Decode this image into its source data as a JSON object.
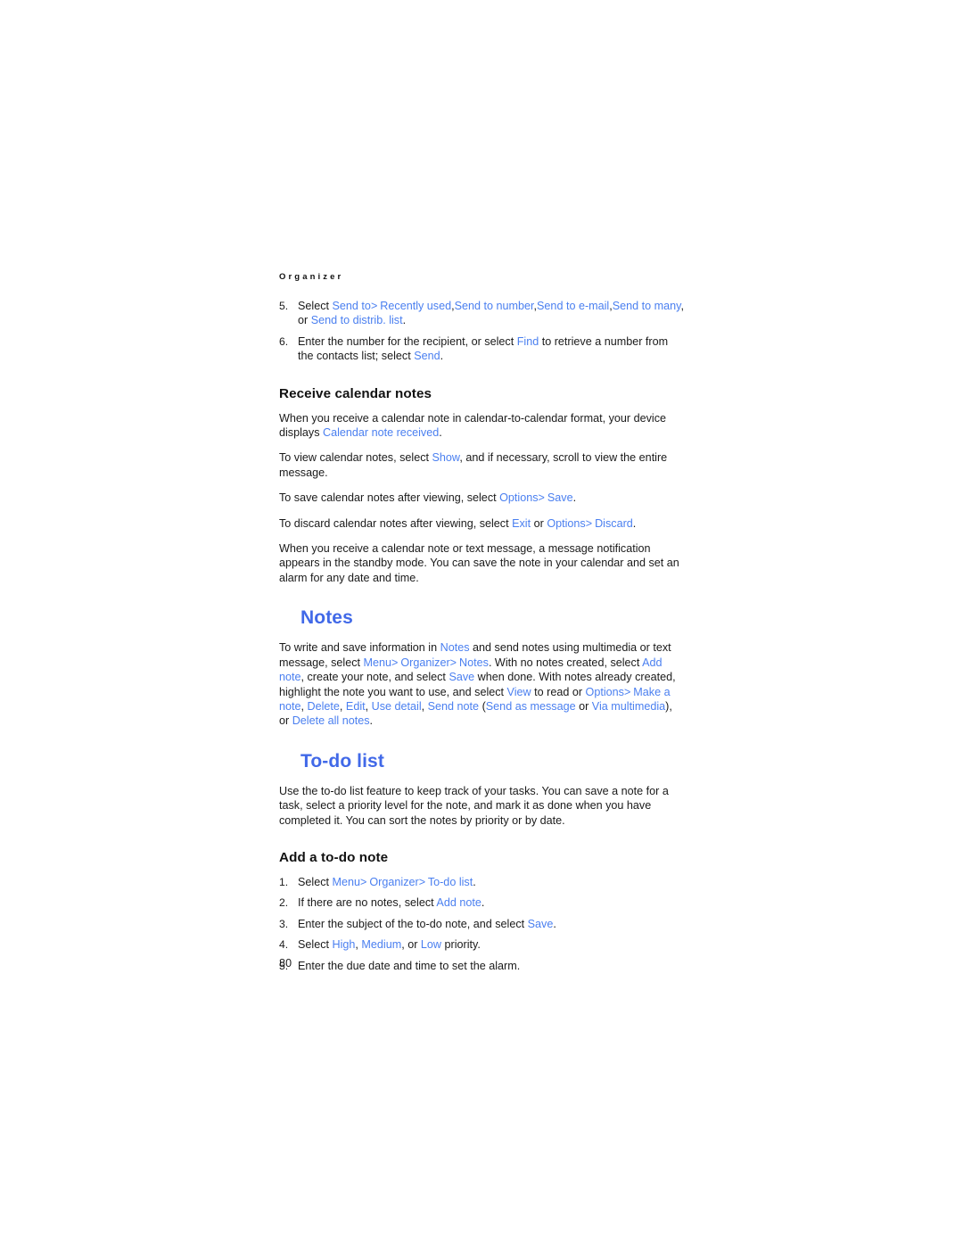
{
  "document": {
    "running_header": "Organizer",
    "page_number": "80",
    "accent_color": "#4a7ff0",
    "heading_color": "#4169e8",
    "body_color": "#1a1a1a"
  },
  "top_list": {
    "items": [
      {
        "number": "5.",
        "segments": [
          {
            "text": "Select ",
            "style": "body"
          },
          {
            "text": "Send to",
            "style": "ui"
          },
          {
            "text": ">",
            "style": "ui-sep"
          },
          {
            "text": " Recently used",
            "style": "ui"
          },
          {
            "text": ",",
            "style": "body"
          },
          {
            "text": "Send to number",
            "style": "ui"
          },
          {
            "text": ",",
            "style": "body"
          },
          {
            "text": "Send to e-mail",
            "style": "ui"
          },
          {
            "text": ",",
            "style": "body"
          },
          {
            "text": "Send to many",
            "style": "ui"
          },
          {
            "text": ", or ",
            "style": "body"
          },
          {
            "text": "Send to distrib. list",
            "style": "ui"
          },
          {
            "text": ".",
            "style": "body"
          }
        ]
      },
      {
        "number": "6.",
        "segments": [
          {
            "text": "Enter the number for the recipient, or select ",
            "style": "body"
          },
          {
            "text": "Find",
            "style": "ui"
          },
          {
            "text": " to retrieve a number from the contacts list; select ",
            "style": "body"
          },
          {
            "text": "Send",
            "style": "ui"
          },
          {
            "text": ".",
            "style": "body"
          }
        ]
      }
    ]
  },
  "receive_calendar_notes": {
    "heading": "Receive calendar notes",
    "paragraphs": [
      {
        "segments": [
          {
            "text": "When you receive a calendar note in calendar-to-calendar format, your device displays ",
            "style": "body"
          },
          {
            "text": "Calendar note received",
            "style": "ui"
          },
          {
            "text": ".",
            "style": "body"
          }
        ]
      },
      {
        "segments": [
          {
            "text": "To view calendar notes, select ",
            "style": "body"
          },
          {
            "text": "Show",
            "style": "ui"
          },
          {
            "text": ", and if necessary, scroll to view the entire message.",
            "style": "body"
          }
        ]
      },
      {
        "segments": [
          {
            "text": "To save calendar notes after viewing, select ",
            "style": "body"
          },
          {
            "text": "Options",
            "style": "ui"
          },
          {
            "text": ">",
            "style": "ui-sep"
          },
          {
            "text": " Save",
            "style": "ui"
          },
          {
            "text": ".",
            "style": "body"
          }
        ]
      },
      {
        "segments": [
          {
            "text": "To discard calendar notes after viewing, select ",
            "style": "body"
          },
          {
            "text": "Exit",
            "style": "ui"
          },
          {
            "text": " or ",
            "style": "body"
          },
          {
            "text": "Options",
            "style": "ui"
          },
          {
            "text": ">",
            "style": "ui-sep"
          },
          {
            "text": " Discard",
            "style": "ui"
          },
          {
            "text": ".",
            "style": "body"
          }
        ]
      },
      {
        "segments": [
          {
            "text": "When you receive a calendar note or text message, a message notification appears in the standby mode. You can save the note in your calendar and set an alarm for any date and time.",
            "style": "body"
          }
        ]
      }
    ]
  },
  "notes_section": {
    "heading": "Notes",
    "paragraphs": [
      {
        "segments": [
          {
            "text": "To write and save information in ",
            "style": "body"
          },
          {
            "text": "Notes",
            "style": "ui"
          },
          {
            "text": " and send notes using multimedia or text message, select ",
            "style": "body"
          },
          {
            "text": "Menu",
            "style": "ui"
          },
          {
            "text": ">",
            "style": "ui-sep"
          },
          {
            "text": " Organizer",
            "style": "ui"
          },
          {
            "text": ">",
            "style": "ui-sep"
          },
          {
            "text": " Notes",
            "style": "ui"
          },
          {
            "text": ". With no notes created, select ",
            "style": "body"
          },
          {
            "text": "Add note",
            "style": "ui"
          },
          {
            "text": ", create your note, and select ",
            "style": "body"
          },
          {
            "text": "Save",
            "style": "ui"
          },
          {
            "text": " when done. With notes already created, highlight the note you want to use, and select ",
            "style": "body"
          },
          {
            "text": "View",
            "style": "ui"
          },
          {
            "text": " to read or ",
            "style": "body"
          },
          {
            "text": "Options",
            "style": "ui"
          },
          {
            "text": ">",
            "style": "ui-sep"
          },
          {
            "text": " Make a note",
            "style": "ui"
          },
          {
            "text": ", ",
            "style": "body"
          },
          {
            "text": "Delete",
            "style": "ui"
          },
          {
            "text": ", ",
            "style": "body"
          },
          {
            "text": "Edit",
            "style": "ui"
          },
          {
            "text": ", ",
            "style": "body"
          },
          {
            "text": "Use detail",
            "style": "ui"
          },
          {
            "text": ", ",
            "style": "body"
          },
          {
            "text": "Send note",
            "style": "ui"
          },
          {
            "text": " (",
            "style": "body"
          },
          {
            "text": "Send as message",
            "style": "ui"
          },
          {
            "text": " or ",
            "style": "body"
          },
          {
            "text": "Via multimedia",
            "style": "ui"
          },
          {
            "text": "), or ",
            "style": "body"
          },
          {
            "text": "Delete all notes",
            "style": "ui"
          },
          {
            "text": ".",
            "style": "body"
          }
        ]
      }
    ]
  },
  "todo_section": {
    "heading": "To-do list",
    "intro": "Use the to-do list feature to keep track of your tasks. You can save a note for a task, select a priority level for the note, and mark it as done when you have completed it. You can sort the notes by priority or by date.",
    "subheading": "Add a to-do note",
    "steps": [
      {
        "number": "1.",
        "segments": [
          {
            "text": "Select ",
            "style": "body"
          },
          {
            "text": "Menu",
            "style": "ui"
          },
          {
            "text": ">",
            "style": "ui-sep"
          },
          {
            "text": " Organizer",
            "style": "ui"
          },
          {
            "text": ">",
            "style": "ui-sep"
          },
          {
            "text": " To-do list",
            "style": "ui"
          },
          {
            "text": ".",
            "style": "body"
          }
        ]
      },
      {
        "number": "2.",
        "segments": [
          {
            "text": "If there are no notes, select ",
            "style": "body"
          },
          {
            "text": "Add note",
            "style": "ui"
          },
          {
            "text": ".",
            "style": "body"
          }
        ]
      },
      {
        "number": "3.",
        "segments": [
          {
            "text": "Enter the subject of the to-do note, and select ",
            "style": "body"
          },
          {
            "text": "Save",
            "style": "ui"
          },
          {
            "text": ".",
            "style": "body"
          }
        ]
      },
      {
        "number": "4.",
        "segments": [
          {
            "text": "Select ",
            "style": "body"
          },
          {
            "text": "High",
            "style": "ui"
          },
          {
            "text": ", ",
            "style": "body"
          },
          {
            "text": "Medium",
            "style": "ui"
          },
          {
            "text": ", or ",
            "style": "body"
          },
          {
            "text": "Low",
            "style": "ui"
          },
          {
            "text": " priority.",
            "style": "body"
          }
        ]
      },
      {
        "number": "5.",
        "segments": [
          {
            "text": "Enter the due date and time to set the alarm.",
            "style": "body"
          }
        ]
      }
    ]
  }
}
